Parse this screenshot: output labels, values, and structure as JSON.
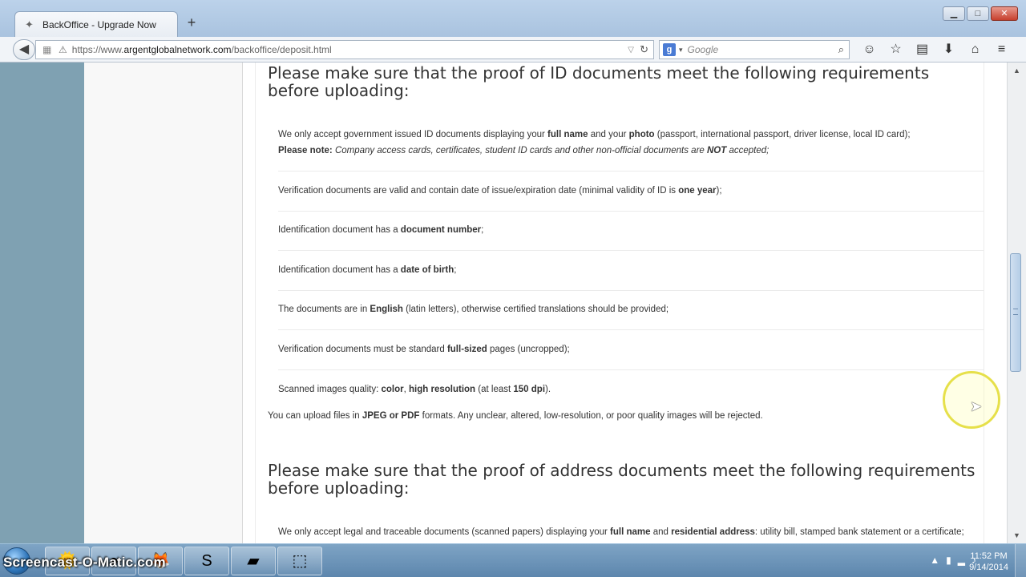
{
  "browser": {
    "tab_title": "BackOffice - Upgrade Now",
    "new_tab_label": "+",
    "url_prefix": "https://www.",
    "url_host": "argentglobalnetwork.com",
    "url_path": "/backoffice/deposit.html",
    "search_placeholder": "Google",
    "window_buttons": {
      "minimize": "▁",
      "maximize": "□",
      "close": "✕"
    }
  },
  "page": {
    "id_section": {
      "title": "Please make sure that the proof of ID documents meet the following requirements before uploading:",
      "items": [
        {
          "line1": [
            "We only accept government issued ID documents displaying your ",
            "full name",
            " and your ",
            "photo",
            " (passport, international passport, driver license, local ID card);"
          ],
          "note_label": "Please note:",
          "note_text_a": " Company access cards, certificates, student ID cards and other non-official documents are ",
          "note_not": "NOT",
          "note_text_b": " accepted;"
        },
        {
          "parts": [
            "Verification documents are valid and contain date of issue/expiration date (minimal validity of ID is ",
            "one year",
            ");"
          ]
        },
        {
          "parts": [
            "Identification document has a ",
            "document number",
            ";"
          ]
        },
        {
          "parts": [
            "Identification document has a ",
            "date of birth",
            ";"
          ]
        },
        {
          "parts": [
            "The documents are in ",
            "English",
            " (latin letters), otherwise certified translations should be provided;"
          ]
        },
        {
          "parts": [
            "Verification documents must be standard ",
            "full-sized",
            " pages (uncropped);"
          ]
        },
        {
          "parts_multi": [
            "Scanned images quality: ",
            "color",
            ", ",
            "high resolution",
            " (at least ",
            "150 dpi",
            ")."
          ]
        }
      ],
      "upload_note": [
        "You can upload files in ",
        "JPEG or PDF",
        " formats. Any unclear, altered, low-resolution, or poor quality images will be rejected."
      ]
    },
    "address_section": {
      "title": "Please make sure that the proof of address documents meet the following requirements before uploading:",
      "first_item": [
        "We only accept legal and traceable documents (scanned papers) displaying your ",
        "full name",
        " and ",
        "residential address",
        ": utility bill, stamped bank statement or a certificate;"
      ]
    }
  },
  "taskbar": {
    "watermark": "Screencast-O-Matic.com",
    "time": "11:52 PM",
    "date": "9/14/2014"
  },
  "colors": {
    "left_band": "#7fa1b2",
    "cursor_highlight": "#e6e04a"
  },
  "icons": [
    "back-arrow-icon",
    "star-icon",
    "reading-list-icon",
    "download-icon",
    "home-icon",
    "menu-icon",
    "search-icon",
    "reload-icon"
  ]
}
